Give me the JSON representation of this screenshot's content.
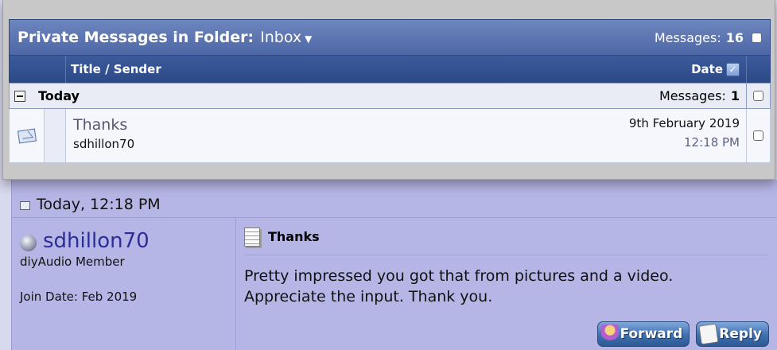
{
  "folder": {
    "title": "Private Messages in Folder:",
    "name": "Inbox",
    "messages_label": "Messages:",
    "messages_count": "16"
  },
  "columns": {
    "title_sender": "Title / Sender",
    "date": "Date"
  },
  "group": {
    "label": "Today",
    "messages_label": "Messages:",
    "messages_count": "1"
  },
  "message_row": {
    "title": "Thanks",
    "sender": "sdhillon70",
    "date": "9th February 2019",
    "time": "12:18 PM"
  },
  "post": {
    "timestamp": "Today, 12:18 PM",
    "username": "sdhillon70",
    "user_title": "diyAudio Member",
    "join_date": "Join Date: Feb 2019",
    "message_title": "Thanks",
    "message_line1": "Pretty impressed you got that from pictures and a video.",
    "message_line2": "Appreciate the input. Thank you.",
    "forward_label": "Forward",
    "reply_label": "Reply"
  },
  "colors": {
    "header_blue": "#4d67a6",
    "column_blue": "#2c4886",
    "post_bg": "#b6b6e6",
    "username": "#2d2d98"
  }
}
